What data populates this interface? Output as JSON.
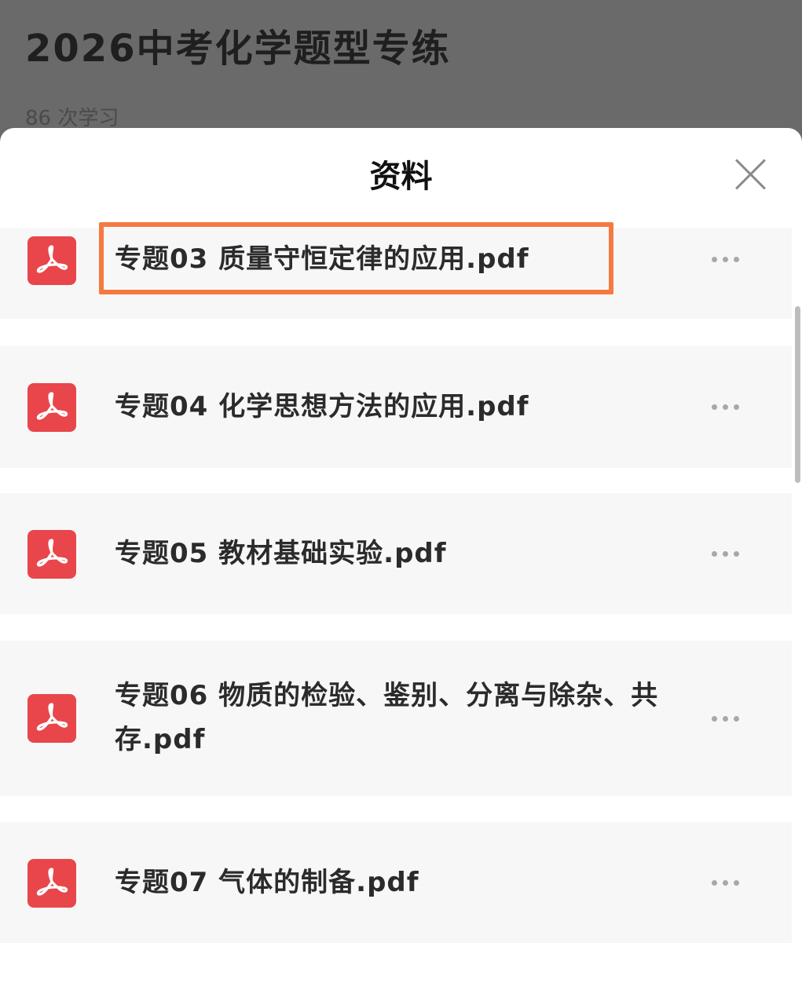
{
  "background": {
    "course_title": "2026中考化学题型专练",
    "study_count": "86 次学习"
  },
  "sheet": {
    "title": "资料",
    "close_icon": "close-icon"
  },
  "files": [
    {
      "name": "专题03 质量守恒定律的应用.pdf",
      "icon": "pdf-icon",
      "highlighted": true
    },
    {
      "name": "专题04 化学思想方法的应用.pdf",
      "icon": "pdf-icon",
      "highlighted": false
    },
    {
      "name": "专题05 教材基础实验.pdf",
      "icon": "pdf-icon",
      "highlighted": false
    },
    {
      "name": "专题06 物质的检验、鉴别、分离与除杂、共存.pdf",
      "icon": "pdf-icon",
      "highlighted": false
    },
    {
      "name": "专题07 气体的制备.pdf",
      "icon": "pdf-icon",
      "highlighted": false
    }
  ],
  "colors": {
    "pdf_icon": "#e8464b",
    "highlight": "#f47a42",
    "backdrop": "#6a6a6a"
  }
}
